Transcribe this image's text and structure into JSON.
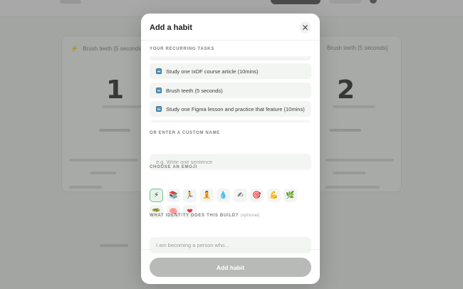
{
  "background": {
    "card_left": {
      "title": "Brush teeth (5 seconds)",
      "count": "1"
    },
    "card_right": {
      "title": "Brush teeth (5 seconds)",
      "count": "2"
    }
  },
  "modal": {
    "title": "Add a habit",
    "close_icon": "close-icon",
    "recurring_label": "YOUR RECURRING TASKS",
    "tasks": [
      {
        "emoji": "books-icon",
        "label": "Study one IxDF course article (10mins)"
      },
      {
        "emoji": "books-icon",
        "label": "Brush teeth (5 seconds)"
      },
      {
        "emoji": "books-icon",
        "label": "Study one Figma lesson and practice that feature (10mins)"
      }
    ],
    "custom_name_label": "OR ENTER A CUSTOM NAME",
    "custom_name_placeholder": "e.g. Write one sentence",
    "emoji_label": "CHOOSE AN EMOJI",
    "emojis": [
      {
        "glyph": "⚡",
        "name": "lightning-icon",
        "selected": true
      },
      {
        "glyph": "📚",
        "name": "books-icon",
        "selected": false
      },
      {
        "glyph": "🏃",
        "name": "runner-icon",
        "selected": false
      },
      {
        "glyph": "🧘",
        "name": "meditation-icon",
        "selected": false
      },
      {
        "glyph": "💧",
        "name": "droplet-icon",
        "selected": false
      },
      {
        "glyph": "✍",
        "name": "writing-hand-icon",
        "selected": false
      },
      {
        "glyph": "🎯",
        "name": "target-icon",
        "selected": false
      },
      {
        "glyph": "💪",
        "name": "flexed-bicep-icon",
        "selected": false
      },
      {
        "glyph": "🌿",
        "name": "herb-icon",
        "selected": false
      },
      {
        "glyph": "🥗",
        "name": "salad-icon",
        "selected": false
      },
      {
        "glyph": "🧠",
        "name": "brain-icon",
        "selected": false
      },
      {
        "glyph": "❤",
        "name": "heart-icon",
        "selected": false
      }
    ],
    "identity_label": "WHAT IDENTITY DOES THIS BUILD?",
    "identity_optional": "(optional)",
    "identity_placeholder": "I am becoming a person who...",
    "submit_label": "Add habit"
  },
  "colors": {
    "selected_emoji_border": "#6fbf8a",
    "submit_disabled": "#b7bab7"
  }
}
